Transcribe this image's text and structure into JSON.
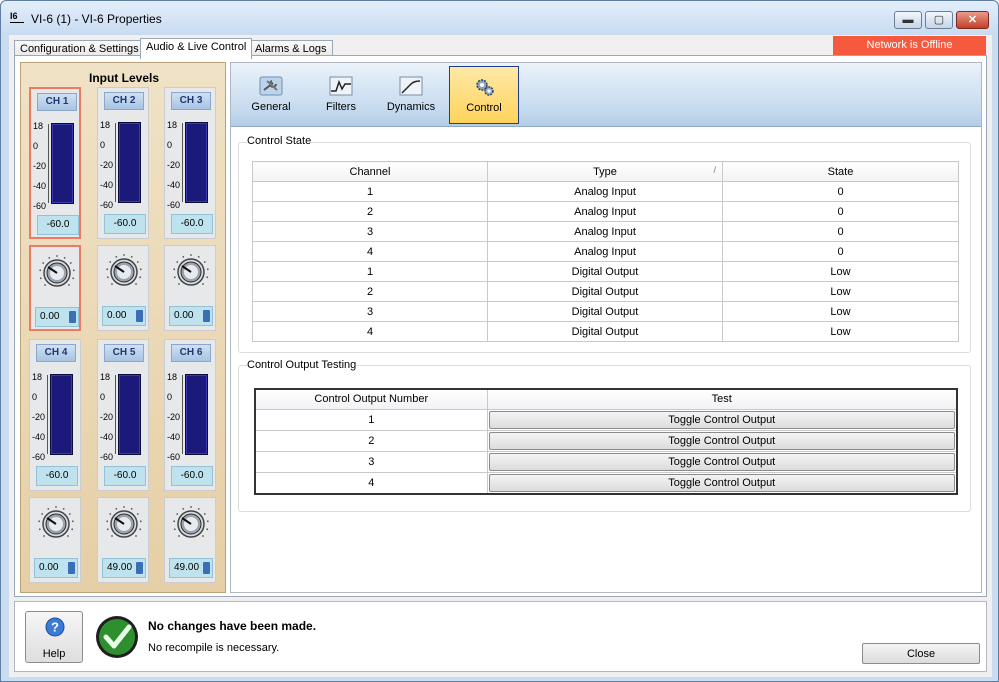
{
  "window": {
    "title": "VI-6 (1) - VI-6 Properties",
    "app_icon_text": "I6",
    "minimize": "▬",
    "maximize": "▢",
    "close": "✕"
  },
  "tabs": [
    {
      "label": "Configuration & Settings"
    },
    {
      "label": "Audio & Live Control"
    },
    {
      "label": "Alarms & Logs"
    }
  ],
  "network_status": "Network is Offline",
  "input_levels": {
    "title": "Input Levels",
    "scale": [
      "18",
      "0",
      "-20",
      "-40",
      "-60"
    ],
    "channels": [
      {
        "label": "CH 1",
        "level": "-60.0",
        "gain": "0.00"
      },
      {
        "label": "CH 2",
        "level": "-60.0",
        "gain": "0.00"
      },
      {
        "label": "CH 3",
        "level": "-60.0",
        "gain": "0.00"
      },
      {
        "label": "CH 4",
        "level": "-60.0",
        "gain": "0.00"
      },
      {
        "label": "CH 5",
        "level": "-60.0",
        "gain": "49.00"
      },
      {
        "label": "CH 6",
        "level": "-60.0",
        "gain": "49.00"
      }
    ]
  },
  "toolbar": {
    "items": [
      {
        "label": "General",
        "icon": "wrench-icon"
      },
      {
        "label": "Filters",
        "icon": "filter-curve-icon"
      },
      {
        "label": "Dynamics",
        "icon": "dynamics-curve-icon"
      },
      {
        "label": "Control",
        "icon": "gears-icon"
      }
    ]
  },
  "control_state": {
    "title": "Control State",
    "columns": [
      "Channel",
      "Type",
      "State"
    ],
    "sort_indicator": "/",
    "rows": [
      [
        "1",
        "Analog Input",
        "0"
      ],
      [
        "2",
        "Analog Input",
        "0"
      ],
      [
        "3",
        "Analog Input",
        "0"
      ],
      [
        "4",
        "Analog Input",
        "0"
      ],
      [
        "1",
        "Digital Output",
        "Low"
      ],
      [
        "2",
        "Digital Output",
        "Low"
      ],
      [
        "3",
        "Digital Output",
        "Low"
      ],
      [
        "4",
        "Digital Output",
        "Low"
      ]
    ]
  },
  "control_output_testing": {
    "title": "Control Output Testing",
    "columns": [
      "Control Output Number",
      "Test"
    ],
    "rows": [
      {
        "number": "1",
        "button": "Toggle Control Output"
      },
      {
        "number": "2",
        "button": "Toggle Control Output"
      },
      {
        "number": "3",
        "button": "Toggle Control Output"
      },
      {
        "number": "4",
        "button": "Toggle Control Output"
      }
    ]
  },
  "footer": {
    "help_label": "Help",
    "message_title": "No changes have been made.",
    "message_sub": "No recompile is necessary.",
    "close_label": "Close"
  }
}
